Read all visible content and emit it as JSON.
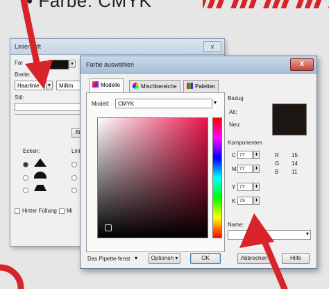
{
  "caption": "• Farbe: CMYK",
  "back_dialog": {
    "title": "Linienstift",
    "close": "x",
    "breite_label": "Breite:",
    "unit_combo": "Haarlinie",
    "unit_combo2": "Millim",
    "stil_label": "Stil:",
    "ecken_label": "Ecken:",
    "linienenden_label": "Linie",
    "hinter_fuellung_label": "Hinter Füllung",
    "mit_objekt_label": "Mi"
  },
  "front_dialog": {
    "title": "Farbe auswählen",
    "close": "X",
    "tabs": [
      {
        "label": "Modelle"
      },
      {
        "label": "Mischbereiche"
      },
      {
        "label": "Paletten"
      }
    ],
    "modell_label": "Modell:",
    "modell_value": "CMYK",
    "bezug_label": "Bezug",
    "alt_label": "Alt:",
    "neu_label": "Neu:",
    "komponenten_label": "Komponenten",
    "cmyk": [
      {
        "label": "C",
        "value": "77"
      },
      {
        "label": "M",
        "value": "77"
      },
      {
        "label": "Y",
        "value": "77"
      },
      {
        "label": "K",
        "value": "73"
      }
    ],
    "rgb": [
      {
        "label": "R",
        "value": "15"
      },
      {
        "label": "G",
        "value": "14"
      },
      {
        "label": "B",
        "value": "11"
      }
    ],
    "name_label": "Name:",
    "eyedropper_label": "Das Pipette-fenst",
    "options_label": "Optionen",
    "ok_label": "OK",
    "cancel_label": "Abbrechen",
    "help_label": "Hilfe",
    "colors": {
      "new_swatch": "#1c1613",
      "accent_red": "#d8232a"
    }
  }
}
